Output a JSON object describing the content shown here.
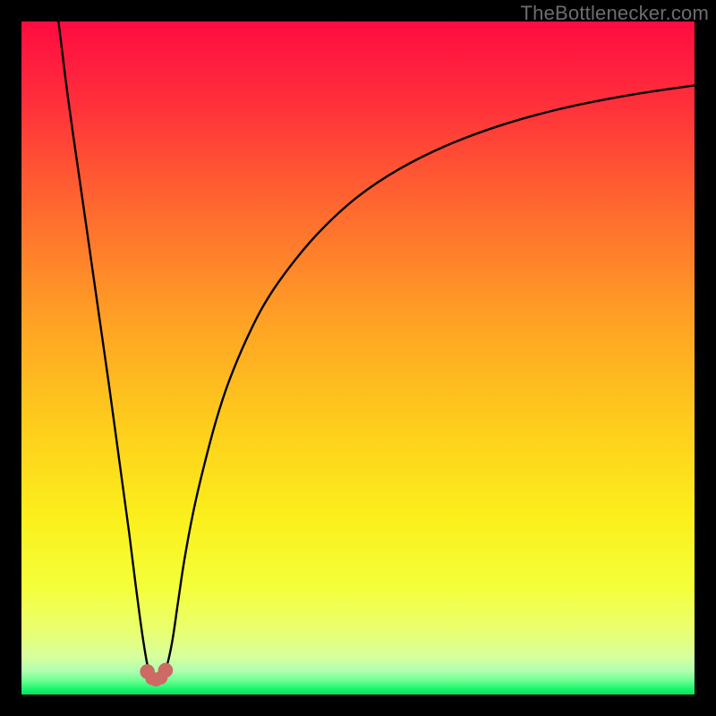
{
  "watermark": "TheBottlenecker.com",
  "chart_data": {
    "type": "line",
    "title": "",
    "xlabel": "",
    "ylabel": "",
    "xlim": [
      0,
      100
    ],
    "ylim": [
      0,
      100
    ],
    "grid": false,
    "legend": false,
    "background_gradient": {
      "stops": [
        {
          "offset": 0.0,
          "color": "#ff0b41"
        },
        {
          "offset": 0.12,
          "color": "#ff2f3b"
        },
        {
          "offset": 0.28,
          "color": "#ff6a2f"
        },
        {
          "offset": 0.45,
          "color": "#ffa324"
        },
        {
          "offset": 0.6,
          "color": "#fecd1c"
        },
        {
          "offset": 0.74,
          "color": "#fbf01c"
        },
        {
          "offset": 0.84,
          "color": "#f4ff3a"
        },
        {
          "offset": 0.905,
          "color": "#eaff70"
        },
        {
          "offset": 0.945,
          "color": "#d6ffa0"
        },
        {
          "offset": 0.965,
          "color": "#afffb0"
        },
        {
          "offset": 0.98,
          "color": "#6aff8f"
        },
        {
          "offset": 0.992,
          "color": "#19f56e"
        },
        {
          "offset": 1.0,
          "color": "#00e35a"
        }
      ]
    },
    "series": [
      {
        "name": "bottleneck-curve",
        "color": "#000000",
        "x": [
          5.5,
          7,
          9,
          11,
          13,
          14.5,
          16,
          17,
          17.8,
          18.5,
          19.0,
          19.5,
          20.0,
          20.6,
          21.2,
          21.8,
          22.5,
          23.3,
          24.2,
          25.5,
          27,
          29,
          31,
          34,
          37,
          41,
          45,
          50,
          56,
          63,
          71,
          80,
          90,
          100
        ],
        "y": [
          100,
          88,
          74,
          60,
          46,
          35,
          24,
          16,
          10,
          5.5,
          3.2,
          2.4,
          2.2,
          2.4,
          3.2,
          5.0,
          8.5,
          14,
          20,
          27,
          33.5,
          41,
          47,
          54,
          59.5,
          65,
          69.5,
          74,
          78,
          81.5,
          84.5,
          87,
          89,
          90.5
        ]
      }
    ],
    "markers": [
      {
        "name": "marker-left",
        "x": 18.7,
        "y": 3.4,
        "r": 1.1,
        "color": "#cc6a63"
      },
      {
        "name": "marker-mid-l",
        "x": 19.4,
        "y": 2.4,
        "r": 1.0,
        "color": "#cc6a63"
      },
      {
        "name": "marker-mid",
        "x": 20.0,
        "y": 2.2,
        "r": 1.0,
        "color": "#cc6a63"
      },
      {
        "name": "marker-mid-r",
        "x": 20.7,
        "y": 2.5,
        "r": 1.0,
        "color": "#cc6a63"
      },
      {
        "name": "marker-right",
        "x": 21.4,
        "y": 3.6,
        "r": 1.1,
        "color": "#cc6a63"
      }
    ]
  }
}
